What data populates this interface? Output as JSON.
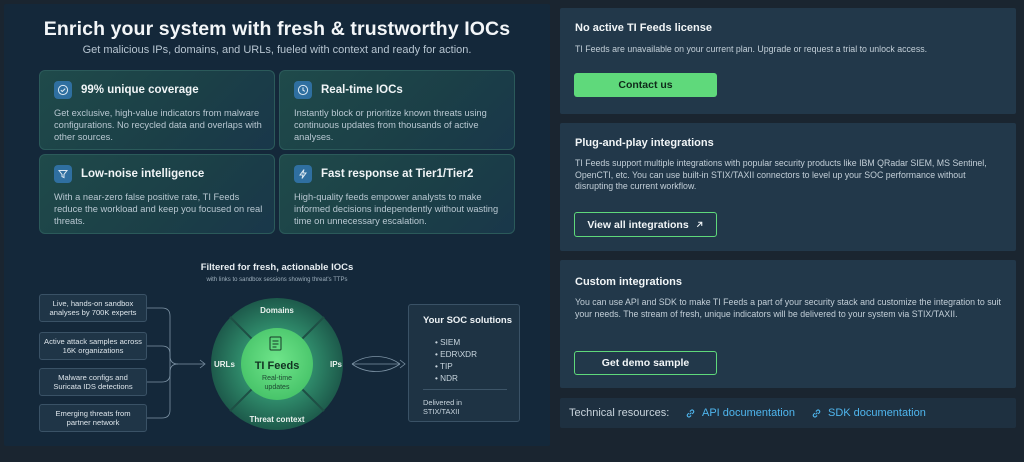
{
  "hero": {
    "title": "Enrich your system with fresh & trustworthy IOCs",
    "subtitle": "Get malicious IPs, domains, and URLs, fueled with context and ready for action."
  },
  "features": [
    {
      "icon": "check-circle-icon",
      "title": "99% unique coverage",
      "description": "Get exclusive, high-value indicators from malware configurations. No recycled data and overlaps with other sources."
    },
    {
      "icon": "clock-icon",
      "title": "Real-time IOCs",
      "description": "Instantly block or prioritize known threats using continuous updates from thousands of active analyses."
    },
    {
      "icon": "filter-icon",
      "title": "Low-noise intelligence",
      "description": "With a near-zero false positive rate, TI Feeds reduce the workload and keep you focused on real threats."
    },
    {
      "icon": "lightning-icon",
      "title": "Fast response at Tier1/Tier2",
      "description": "High-quality feeds empower analysts to make informed decisions independently without wasting time on unnecessary escalation."
    }
  ],
  "flow": {
    "title": "Filtered for fresh, actionable IOCs",
    "subtitle": "with links to sandbox sessions showing threat's TTPs",
    "sources": [
      "Live, hands-on sandbox analyses by 700K experts",
      "Active attack samples across 16K organizations",
      "Malware configs and Suricata IDS detections",
      "Emerging threats from partner network"
    ],
    "ring": {
      "top": "Domains",
      "left": "URLs",
      "right": "IPs",
      "bottom": "Threat context",
      "center_title": "TI Feeds",
      "center_sub_line1": "Real-time",
      "center_sub_line2": "updates"
    },
    "soc": {
      "title": "Your SOC solutions",
      "items": [
        "SIEM",
        "EDR\\XDR",
        "TIP",
        "NDR"
      ],
      "footer_line1": "Delivered in",
      "footer_line2": "STIX/TAXII"
    }
  },
  "license": {
    "title": "No active TI Feeds license",
    "text": "TI Feeds are unavailable on your current plan. Upgrade or request a trial to unlock access.",
    "button": "Contact us"
  },
  "plug": {
    "title": "Plug-and-play integrations",
    "text": "TI Feeds support multiple integrations with popular security products like IBM QRadar SIEM, MS Sentinel, OpenCTI, etc. You can use built-in STIX/TAXII connectors to level up your SOC performance without disrupting the current workflow.",
    "button": "View all integrations"
  },
  "custom": {
    "title": "Custom integrations",
    "text": "You can use API and SDK to make TI Feeds a part of your security stack and customize the integration to suit your needs. The stream of fresh, unique indicators will be delivered to your system via STIX/TAXII.",
    "button": "Get demo sample"
  },
  "tech": {
    "label": "Technical resources:",
    "api_link": "API documentation",
    "sdk_link": "SDK documentation"
  },
  "colors": {
    "accent_green": "#5fd97b",
    "link_blue": "#4fb6ee",
    "panel_bg": "#14283a",
    "card_bg": "#22384a"
  }
}
